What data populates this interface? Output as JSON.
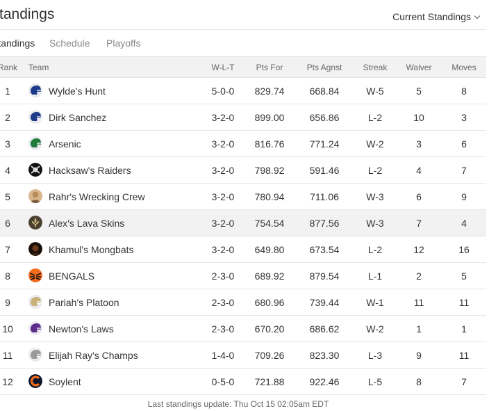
{
  "header": {
    "title": "Standings",
    "select_label": "Current Standings"
  },
  "tabs": [
    {
      "label": "Standings",
      "active": true
    },
    {
      "label": "Schedule",
      "active": false
    },
    {
      "label": "Playoffs",
      "active": false
    }
  ],
  "columns": {
    "rank": "Rank",
    "team": "Team",
    "wlt": "W-L-T",
    "pts_for": "Pts For",
    "pts_agnst": "Pts Agnst",
    "streak": "Streak",
    "waiver": "Waiver",
    "moves": "Moves"
  },
  "rows": [
    {
      "rank": "1",
      "team": "Wylde's Hunt",
      "wlt": "5-0-0",
      "pts_for": "829.74",
      "pts_agnst": "668.84",
      "streak": "W-5",
      "waiver": "5",
      "moves": "8",
      "logo": "helmet-logo-navy",
      "logo_color": "#1d3b8a"
    },
    {
      "rank": "2",
      "team": "Dirk Sanchez",
      "wlt": "3-2-0",
      "pts_for": "899.00",
      "pts_agnst": "656.86",
      "streak": "L-2",
      "waiver": "10",
      "moves": "3",
      "logo": "helmet-logo-navy",
      "logo_color": "#1d3b8a"
    },
    {
      "rank": "3",
      "team": "Arsenic",
      "wlt": "3-2-0",
      "pts_for": "816.76",
      "pts_agnst": "771.24",
      "streak": "W-2",
      "waiver": "3",
      "moves": "6",
      "logo": "helmet-logo-green",
      "logo_color": "#1f7a3a"
    },
    {
      "rank": "4",
      "team": "Hacksaw's Raiders",
      "wlt": "3-2-0",
      "pts_for": "798.92",
      "pts_agnst": "591.46",
      "streak": "L-2",
      "waiver": "4",
      "moves": "7",
      "logo": "raiders-shield-logo",
      "logo_color": "#111111"
    },
    {
      "rank": "5",
      "team": "Rahr's Wrecking Crew",
      "wlt": "3-2-0",
      "pts_for": "780.94",
      "pts_agnst": "711.06",
      "streak": "W-3",
      "waiver": "6",
      "moves": "9",
      "logo": "photo-avatar-logo",
      "logo_color": "#b88a5a"
    },
    {
      "rank": "6",
      "team": "Alex's Lava Skins",
      "wlt": "3-2-0",
      "pts_for": "754.54",
      "pts_agnst": "877.56",
      "streak": "W-3",
      "waiver": "7",
      "moves": "4",
      "logo": "fleur-de-lis-logo",
      "logo_color": "#6b5a3a",
      "highlight": true
    },
    {
      "rank": "7",
      "team": "Khamul's Mongbats",
      "wlt": "3-2-0",
      "pts_for": "649.80",
      "pts_agnst": "673.54",
      "streak": "L-2",
      "waiver": "12",
      "moves": "16",
      "logo": "dark-avatar-logo",
      "logo_color": "#2a1a10"
    },
    {
      "rank": "8",
      "team": "BENGALS",
      "wlt": "2-3-0",
      "pts_for": "689.92",
      "pts_agnst": "879.54",
      "streak": "L-1",
      "waiver": "2",
      "moves": "5",
      "logo": "bengals-stripe-logo",
      "logo_color": "#f26b1d"
    },
    {
      "rank": "9",
      "team": "Pariah's Platoon",
      "wlt": "2-3-0",
      "pts_for": "680.96",
      "pts_agnst": "739.44",
      "streak": "W-1",
      "waiver": "11",
      "moves": "11",
      "logo": "helmet-logo-gold",
      "logo_color": "#c8b27a"
    },
    {
      "rank": "10",
      "team": "Newton's Laws",
      "wlt": "2-3-0",
      "pts_for": "670.20",
      "pts_agnst": "686.62",
      "streak": "W-2",
      "waiver": "1",
      "moves": "1",
      "logo": "helmet-logo-purple",
      "logo_color": "#5a2d8a"
    },
    {
      "rank": "11",
      "team": "Elijah Ray's Champs",
      "wlt": "1-4-0",
      "pts_for": "709.26",
      "pts_agnst": "823.30",
      "streak": "L-3",
      "waiver": "9",
      "moves": "11",
      "logo": "helmet-logo-silver",
      "logo_color": "#9a9a9a"
    },
    {
      "rank": "12",
      "team": "Soylent",
      "wlt": "0-5-0",
      "pts_for": "721.88",
      "pts_agnst": "922.46",
      "streak": "L-5",
      "waiver": "8",
      "moves": "7",
      "logo": "bears-c-logo",
      "logo_color": "#f26b1d"
    }
  ],
  "footer": {
    "text": "Last standings update: Thu Oct 15 02:05am EDT"
  }
}
